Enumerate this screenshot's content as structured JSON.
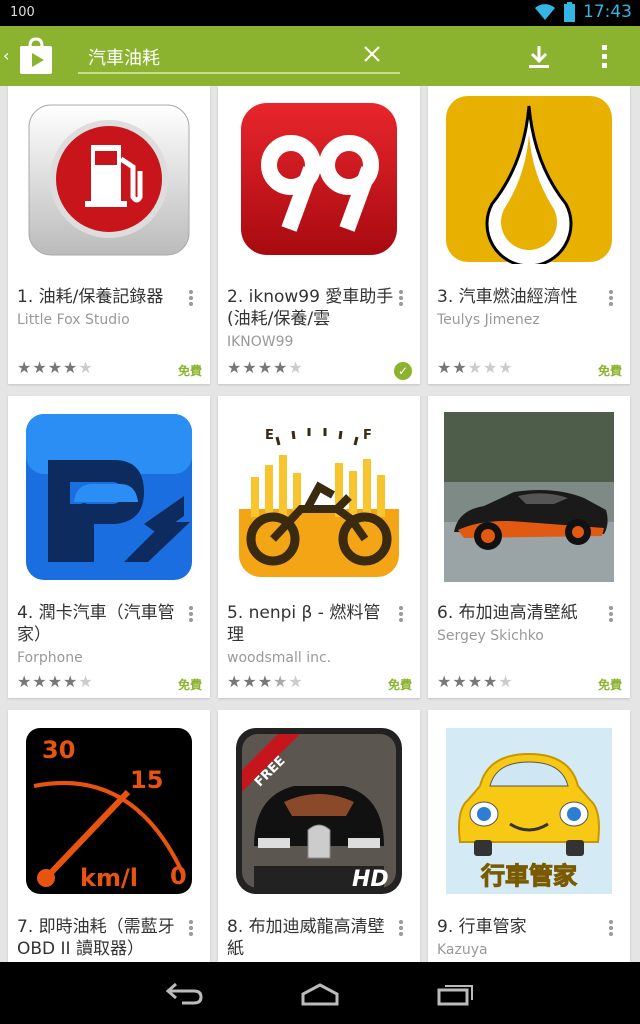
{
  "status": {
    "battery_level": "100",
    "time": "17:43"
  },
  "search": {
    "query": "汽車油耗"
  },
  "apps": [
    {
      "title": "1. 油耗/保養記錄器",
      "developer": "Little Fox Studio",
      "rating": 4.5,
      "price": "免費",
      "installed": false
    },
    {
      "title": "2. iknow99 愛車助手 (油耗/保養/雲",
      "developer": "IKNOW99",
      "rating": 4.5,
      "price": "",
      "installed": true
    },
    {
      "title": "3. 汽車燃油經濟性",
      "developer": "Teulys Jimenez",
      "rating": 2.5,
      "price": "免費",
      "installed": false
    },
    {
      "title": "4. 潤卡汽車（汽車管家）",
      "developer": "Forphone",
      "rating": 4.0,
      "price": "免費",
      "installed": false
    },
    {
      "title": "5. nenpi β - 燃料管理",
      "developer": "woodsmall inc.",
      "rating": 3.5,
      "price": "免費",
      "installed": false
    },
    {
      "title": "6. 布加迪高清壁紙",
      "developer": "Sergey Skichko",
      "rating": 4.5,
      "price": "免費",
      "installed": false
    },
    {
      "title": "7. 即時油耗（需藍牙 OBD II 讀取器）",
      "developer": "",
      "rating": 0,
      "price": "",
      "installed": false
    },
    {
      "title": "8. 布加迪威龍高清壁紙",
      "developer": "",
      "rating": 0,
      "price": "",
      "installed": false
    },
    {
      "title": "9. 行車管家",
      "developer": "Kazuya",
      "rating": 0,
      "price": "",
      "installed": false
    }
  ],
  "icons": {
    "app7": {
      "top": "30",
      "mid": "15",
      "zero": "0",
      "unit": "km/l"
    },
    "app8": {
      "ribbon": "FREE",
      "badge": "HD"
    },
    "app9": {
      "caption": "行車管家"
    },
    "app5": {
      "e": "E",
      "f": "F"
    }
  }
}
